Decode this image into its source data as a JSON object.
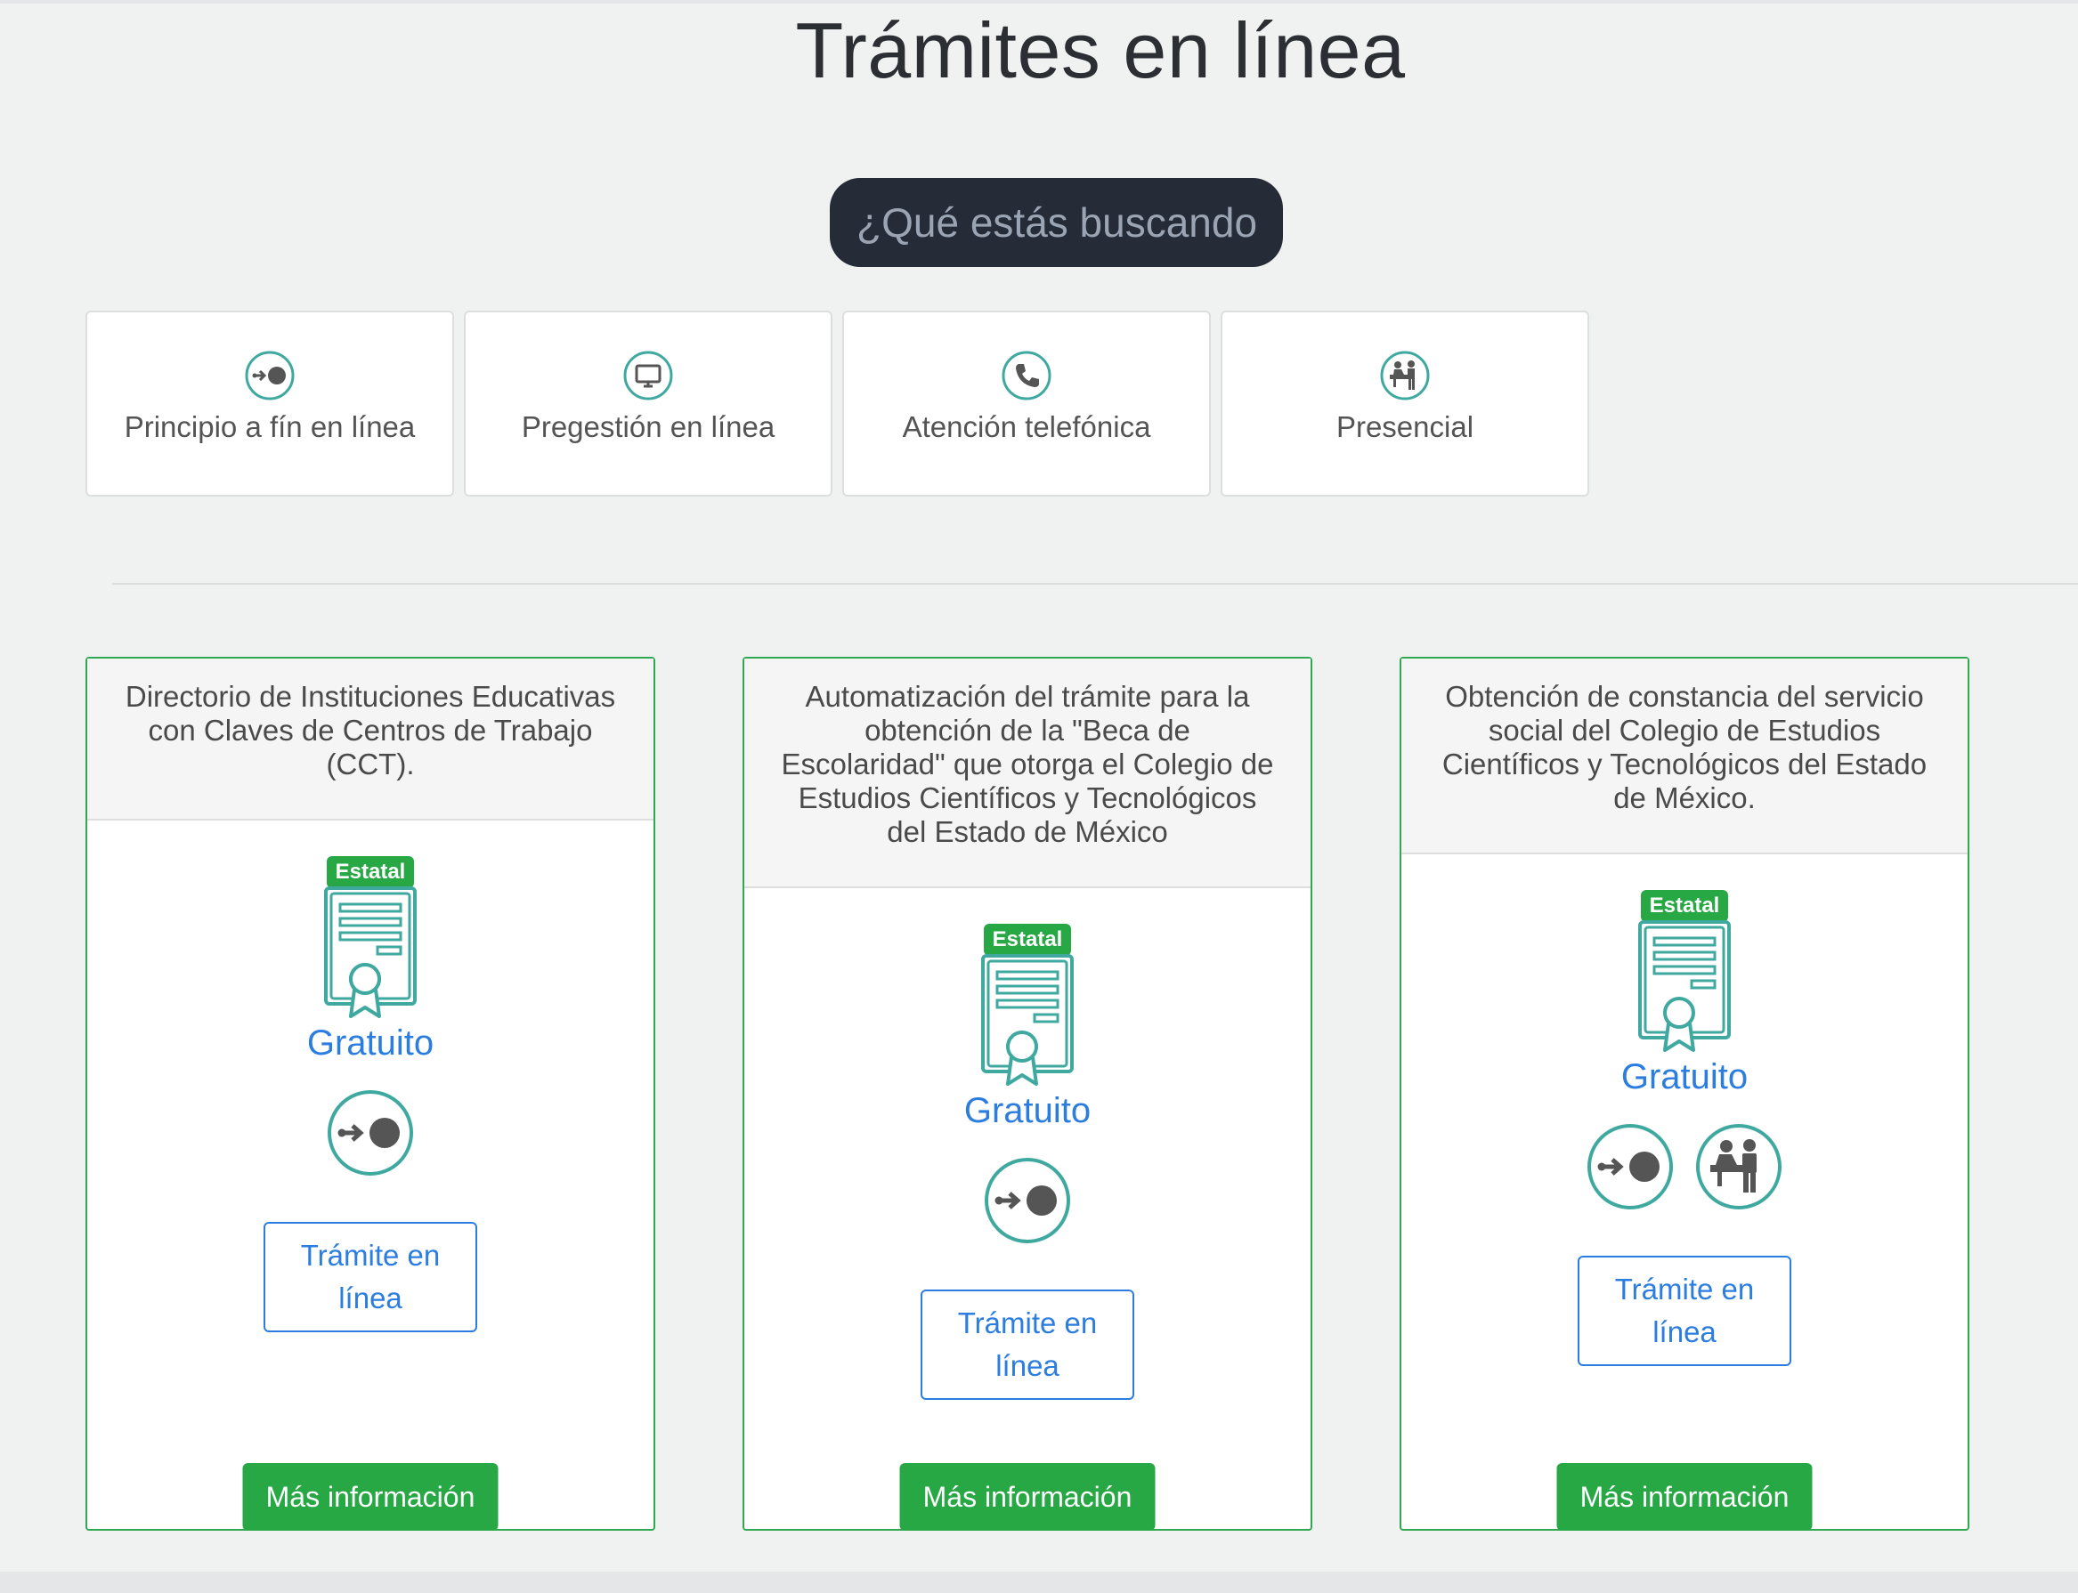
{
  "page": {
    "title": "Trámites en línea",
    "search_placeholder": "¿Qué estás buscando?"
  },
  "colors": {
    "accent_green": "#28a745",
    "link_blue": "#2b7de0",
    "icon_teal": "#3fa9a0",
    "search_bg": "#262b38"
  },
  "filters": [
    {
      "label": "Principio a fín en línea",
      "icon": "arrow-dot-icon"
    },
    {
      "label": "Pregestión en línea",
      "icon": "monitor-icon"
    },
    {
      "label": "Atención telefónica",
      "icon": "phone-icon"
    },
    {
      "label": "Presencial",
      "icon": "people-desk-icon"
    }
  ],
  "cards": [
    {
      "title": "Directorio de Instituciones Educativas con Claves de Centros de Trabajo (CCT).",
      "badge": "Estatal",
      "price": "Gratuito",
      "channels": [
        "arrow-dot-icon"
      ],
      "tramite_label": "Trámite en línea",
      "info_label": "Más información"
    },
    {
      "title": "Automatización del trámite para la obtención de la \"Beca de Escolaridad\" que otorga el Colegio de Estudios Científicos y Tecnológicos del Estado de México",
      "badge": "Estatal",
      "price": "Gratuito",
      "channels": [
        "arrow-dot-icon"
      ],
      "tramite_label": "Trámite en línea",
      "info_label": "Más información"
    },
    {
      "title": "Obtención de constancia del servicio social del Colegio de Estudios Científicos y Tecnológicos del Estado de México.",
      "badge": "Estatal",
      "price": "Gratuito",
      "channels": [
        "arrow-dot-icon",
        "people-desk-icon"
      ],
      "tramite_label": "Trámite en línea",
      "info_label": "Más información"
    }
  ]
}
